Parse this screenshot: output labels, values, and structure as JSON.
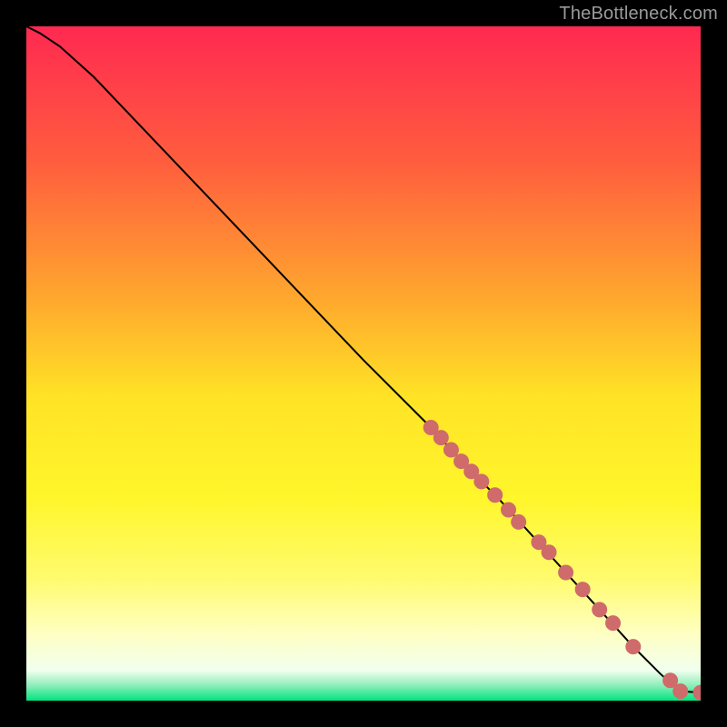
{
  "attribution": "TheBottleneck.com",
  "colors": {
    "frame": "#000000",
    "attribution_text": "#9a9a9a",
    "curve": "#000000",
    "marker_fill": "#cf6b6a",
    "marker_stroke": "#cf6b6a",
    "gradient_stops": [
      {
        "offset": 0.0,
        "color": "#ff2951"
      },
      {
        "offset": 0.2,
        "color": "#ff5d3e"
      },
      {
        "offset": 0.4,
        "color": "#ffa62e"
      },
      {
        "offset": 0.55,
        "color": "#ffe326"
      },
      {
        "offset": 0.7,
        "color": "#fff62b"
      },
      {
        "offset": 0.82,
        "color": "#fffb6f"
      },
      {
        "offset": 0.9,
        "color": "#ffffc2"
      },
      {
        "offset": 0.955,
        "color": "#f1ffee"
      },
      {
        "offset": 0.975,
        "color": "#9befc0"
      },
      {
        "offset": 1.0,
        "color": "#00e57f"
      }
    ]
  },
  "chart_data": {
    "type": "line",
    "title": "",
    "xlabel": "",
    "ylabel": "",
    "xlim": [
      0,
      100
    ],
    "ylim": [
      0,
      100
    ],
    "grid": false,
    "legend": false,
    "series": [
      {
        "name": "curve",
        "show_markers": false,
        "x": [
          0,
          2,
          5,
          10,
          20,
          30,
          40,
          50,
          60,
          65,
          70,
          75,
          80,
          85,
          90,
          92,
          94,
          96,
          97,
          100
        ],
        "y": [
          100,
          99,
          97,
          92.5,
          82,
          71.5,
          61,
          50.5,
          40.5,
          35,
          30,
          24.5,
          19,
          13.5,
          8,
          6,
          4,
          2.2,
          1.4,
          1.2
        ]
      },
      {
        "name": "highlighted-points",
        "show_markers": true,
        "x": [
          60,
          61.5,
          63,
          64.5,
          66,
          67.5,
          69.5,
          71.5,
          73,
          76,
          77.5,
          80,
          82.5,
          85,
          87,
          90,
          95.5,
          97,
          100
        ],
        "y": [
          40.5,
          39,
          37.2,
          35.5,
          34,
          32.5,
          30.5,
          28.3,
          26.5,
          23.5,
          22,
          19,
          16.5,
          13.5,
          11.5,
          8,
          3,
          1.4,
          1.2
        ]
      }
    ]
  }
}
